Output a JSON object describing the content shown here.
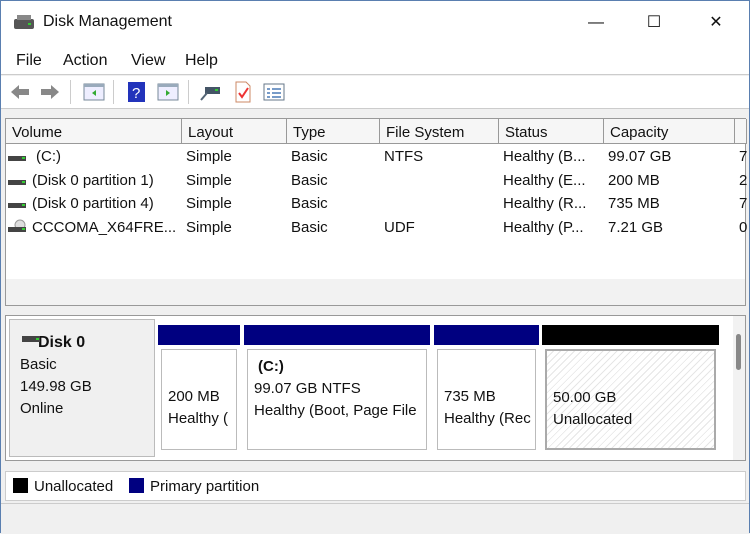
{
  "window": {
    "title": "Disk Management",
    "minimize": "—",
    "maximize": "☐",
    "close": "✕"
  },
  "menu": [
    "File",
    "Action",
    "View",
    "Help"
  ],
  "toolbar": [
    "back-icon",
    "forward-icon",
    "show-hide-console-tree-icon",
    "help-icon",
    "show-hide-action-pane-icon",
    "connect-disk-icon",
    "properties-icon",
    "list-view-icon"
  ],
  "columns": [
    "Volume",
    "Layout",
    "Type",
    "File System",
    "Status",
    "Capacity",
    ""
  ],
  "rows": [
    {
      "volume": "(C:)",
      "layout": "Simple",
      "type": "Basic",
      "fs": "NTFS",
      "status": "Healthy (B...",
      "capacity": "99.07 GB",
      "extra": "7",
      "icon": "drive"
    },
    {
      "volume": "(Disk 0 partition 1)",
      "layout": "Simple",
      "type": "Basic",
      "fs": "",
      "status": "Healthy (E...",
      "capacity": "200 MB",
      "extra": "2",
      "icon": "drive"
    },
    {
      "volume": "(Disk 0 partition 4)",
      "layout": "Simple",
      "type": "Basic",
      "fs": "",
      "status": "Healthy (R...",
      "capacity": "735 MB",
      "extra": "7",
      "icon": "drive"
    },
    {
      "volume": "CCCOMA_X64FRE...",
      "layout": "Simple",
      "type": "Basic",
      "fs": "UDF",
      "status": "Healthy (P...",
      "capacity": "7.21 GB",
      "extra": "0",
      "icon": "cd"
    }
  ],
  "disk": {
    "name": "Disk 0",
    "type": "Basic",
    "size": "149.98 GB",
    "state": "Online",
    "partitions": [
      {
        "name": "",
        "size": "200 MB",
        "status": "Healthy (",
        "kind": "primary"
      },
      {
        "name": "(C:)",
        "size": "99.07 GB NTFS",
        "status": "Healthy (Boot, Page File",
        "kind": "primary"
      },
      {
        "name": "",
        "size": "735 MB",
        "status": "Healthy (Rec",
        "kind": "primary"
      },
      {
        "name": "",
        "size": "50.00 GB",
        "status": "Unallocated",
        "kind": "unallocated"
      }
    ]
  },
  "legend": [
    {
      "label": "Unallocated",
      "color": "#000000"
    },
    {
      "label": "Primary partition",
      "color": "#000080"
    }
  ]
}
